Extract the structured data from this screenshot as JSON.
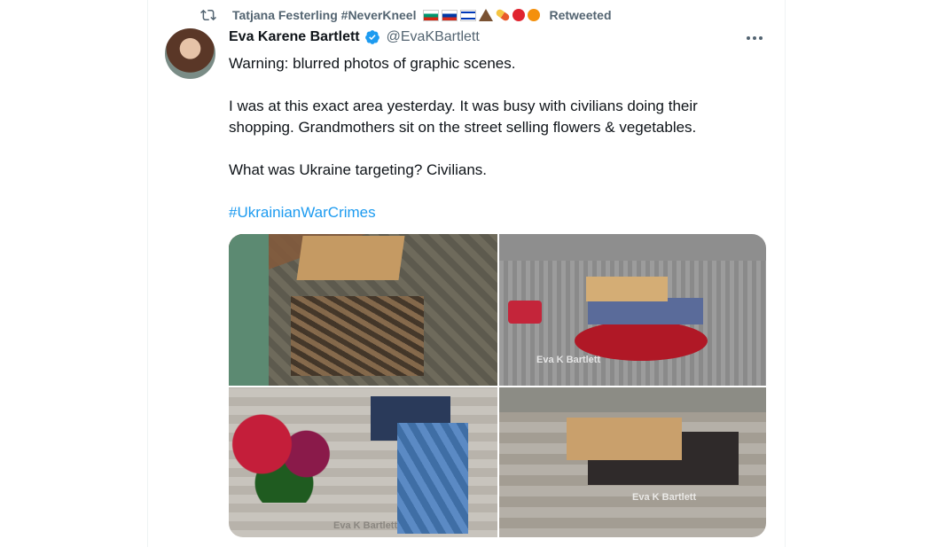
{
  "retweet": {
    "retweeter_name": "Tatjana Festerling #NeverKneel",
    "label": "Retweeted",
    "emoji_icons": [
      "flag-bulgaria-icon",
      "flag-russia-icon",
      "flag-israel-icon",
      "volcano-icon",
      "pill-icon",
      "tomato-icon",
      "orange-icon"
    ]
  },
  "author": {
    "display_name": "Eva Karene Bartlett",
    "handle": "@EvaKBartlett",
    "verified": true
  },
  "tweet": {
    "paragraphs": [
      "Warning: blurred photos of graphic scenes.",
      "I was at this exact area yesterday. It was busy with civilians doing their shopping. Grandmothers sit on the street selling flowers & vegetables.",
      "What was Ukraine targeting? Civilians."
    ],
    "hashtag": "#UkrainianWarCrimes"
  },
  "media": {
    "photo_count": 4,
    "watermarks": [
      "Eva K Bartlett",
      "Eva K Bartlett",
      "Eva K Bartlett"
    ]
  },
  "colors": {
    "link": "#1d9bf0",
    "muted": "#536471",
    "verified": "#1d9bf0"
  }
}
